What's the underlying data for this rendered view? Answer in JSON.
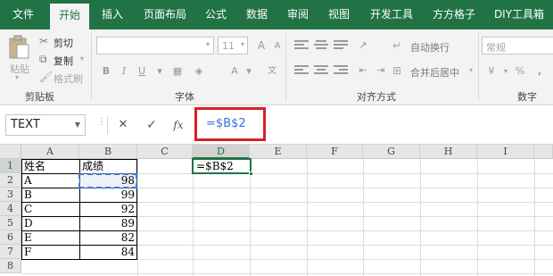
{
  "tabs": [
    {
      "label": "文件"
    },
    {
      "label": "开始"
    },
    {
      "label": "插入"
    },
    {
      "label": "页面布局"
    },
    {
      "label": "公式"
    },
    {
      "label": "数据"
    },
    {
      "label": "审阅"
    },
    {
      "label": "视图"
    },
    {
      "label": "开发工具"
    },
    {
      "label": "方方格子"
    },
    {
      "label": "DIY工具箱"
    }
  ],
  "ribbon": {
    "clipboard": {
      "paste": "粘贴",
      "cut": "剪切",
      "copy": "复制",
      "format_painter": "格式刷",
      "label": "剪贴板"
    },
    "font": {
      "size": "11",
      "bold": "B",
      "italic": "I",
      "underline": "U",
      "grow": "A",
      "shrink": "A",
      "font_color": "A",
      "label": "字体"
    },
    "alignment": {
      "wrap_text": "自动换行",
      "merge_center": "合并后居中",
      "label": "对齐方式"
    },
    "number": {
      "format": "常规",
      "percent": "%",
      "comma": ",",
      "label": "数字"
    }
  },
  "formula_bar": {
    "name_box": "TEXT",
    "cancel": "✕",
    "enter": "✓",
    "fx": "fx",
    "formula": "=$B$2"
  },
  "sheet": {
    "columns": [
      "A",
      "B",
      "C",
      "D",
      "E",
      "F",
      "G",
      "H",
      "I"
    ],
    "rows": [
      "1",
      "2",
      "3",
      "4",
      "5",
      "6",
      "7",
      "8"
    ],
    "header": {
      "name": "姓名",
      "score": "成绩"
    },
    "data": [
      {
        "name": "A",
        "score": "98"
      },
      {
        "name": "B",
        "score": "99"
      },
      {
        "name": "C",
        "score": "92"
      },
      {
        "name": "D",
        "score": "89"
      },
      {
        "name": "E",
        "score": "82"
      },
      {
        "name": "F",
        "score": "84"
      }
    ],
    "editing_cell": "=$B$2"
  },
  "colors": {
    "accent": "#217346",
    "highlight_box": "#d6202a",
    "reference_blue": "#3b6fd6"
  }
}
